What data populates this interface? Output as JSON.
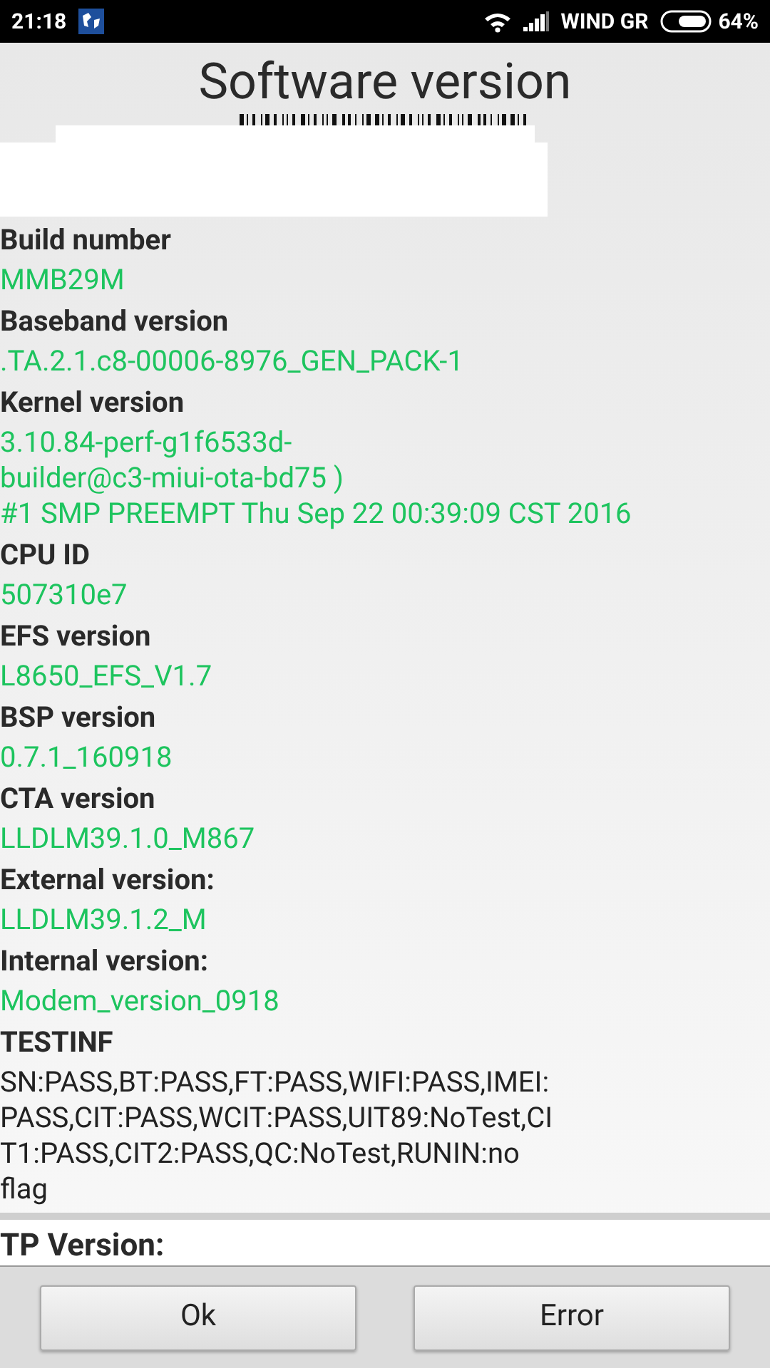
{
  "status_bar": {
    "time": "21:18",
    "carrier": "WIND GR",
    "battery": "64%"
  },
  "title": "Software version",
  "items": [
    {
      "kind": "version",
      "label": "Build number",
      "value": "MMB29M"
    },
    {
      "kind": "version",
      "label": "Baseband version",
      "value": ".TA.2.1.c8-00006-8976_GEN_PACK-1"
    },
    {
      "kind": "version",
      "label": "Kernel version",
      "value": "3.10.84-perf-g1f6533d-\nbuilder@c3-miui-ota-bd75 )\n#1 SMP PREEMPT Thu Sep 22 00:39:09 CST 2016"
    },
    {
      "kind": "version",
      "label": "CPU ID",
      "value": "507310e7"
    },
    {
      "kind": "version",
      "label": "EFS version",
      "value": "L8650_EFS_V1.7"
    },
    {
      "kind": "version",
      "label": "BSP version",
      "value": "0.7.1_160918"
    },
    {
      "kind": "version",
      "label": "CTA version",
      "value": "LLDLM39.1.0_M867"
    },
    {
      "kind": "version",
      "label": "External version:",
      "value": "LLDLM39.1.2_M"
    },
    {
      "kind": "version",
      "label": "Internal version:",
      "value": "Modem_version_0918"
    },
    {
      "kind": "test",
      "label": "TESTINF",
      "value": "SN:PASS,BT:PASS,FT:PASS,WIFI:PASS,IMEI:\nPASS,CIT:PASS,WCIT:PASS,UIT89:NoTest,CI\nT1:PASS,CIT2:PASS,QC:NoTest,RUNIN:no\nflag"
    }
  ],
  "tp_section": {
    "label": "TP Version:"
  },
  "buttons": [
    "Ok",
    "Error"
  ]
}
